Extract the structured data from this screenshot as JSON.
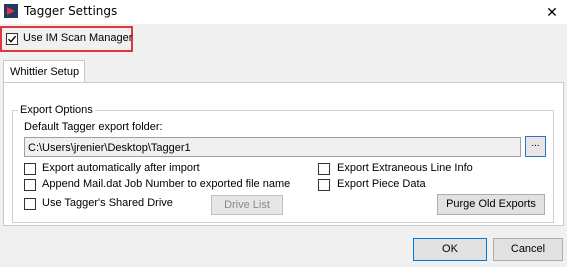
{
  "window": {
    "title": "Tagger Settings",
    "close_glyph": "✕",
    "accent_color": "#e0373e"
  },
  "top_option": {
    "label": "Use IM Scan Manager",
    "checked": true
  },
  "tabs": [
    {
      "label": "Whittier Setup",
      "selected": true
    }
  ],
  "export_options": {
    "group_title": "Export Options",
    "folder_label": "Default Tagger export folder:",
    "folder_value": "C:\\Users\\jrenier\\Desktop\\Tagger1",
    "browse_label": "...",
    "checkboxes": [
      {
        "label": "Export automatically after import",
        "checked": false
      },
      {
        "label": "Append Mail.dat Job Number to exported file name",
        "checked": false
      },
      {
        "label": "Use Tagger's Shared Drive",
        "checked": false
      },
      {
        "label": "Export Extraneous Line Info",
        "checked": false
      },
      {
        "label": "Export Piece Data",
        "checked": false
      }
    ],
    "drive_list_label": "Drive List",
    "purge_label": "Purge Old Exports"
  },
  "footer": {
    "ok_label": "OK",
    "cancel_label": "Cancel"
  }
}
